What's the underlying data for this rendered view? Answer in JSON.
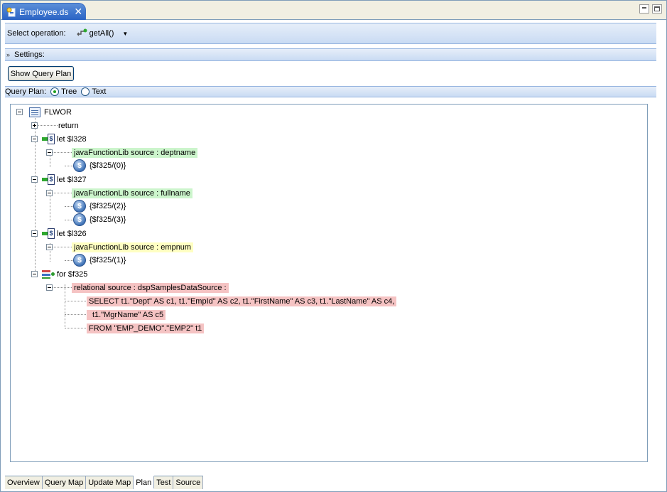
{
  "editor": {
    "tab_title": "Employee.ds",
    "close_glyph": "✕"
  },
  "operation": {
    "label": "Select operation:",
    "value": "getAll()"
  },
  "settings": {
    "label": "Settings:"
  },
  "show_plan_button": "Show Query Plan",
  "query_plan": {
    "label": "Query Plan:",
    "options": [
      {
        "label": "Tree",
        "selected": true
      },
      {
        "label": "Text",
        "selected": false
      }
    ]
  },
  "tree": {
    "root": "FLWOR",
    "return": "return",
    "let1": "let $l328",
    "let1_source": "javaFunctionLib source : deptname",
    "let1_val": "{$f325/(0)}",
    "let2": "let $l327",
    "let2_source": "javaFunctionLib source : fullname",
    "let2_val_a": "{$f325/(2)}",
    "let2_val_b": "{$f325/(3)}",
    "let3": "let $l326",
    "let3_source": "javaFunctionLib source : empnum",
    "let3_val": "{$f325/(1)}",
    "for": "for $f325",
    "rel_source": "relational source : dspSamplesDataSource :",
    "sql1": "SELECT t1.\"Dept\" AS c1, t1.\"EmpId\" AS c2, t1.\"FirstName\" AS c3, t1.\"LastName\" AS c4,",
    "sql2": "t1.\"MgrName\" AS c5",
    "sql3": "FROM \"EMP_DEMO\".\"EMP2\" t1"
  },
  "bottom_tabs": [
    {
      "label": "Overview",
      "active": false
    },
    {
      "label": "Query Map",
      "active": false
    },
    {
      "label": "Update Map",
      "active": false
    },
    {
      "label": "Plan",
      "active": true
    },
    {
      "label": "Test",
      "active": false
    },
    {
      "label": "Source",
      "active": false
    }
  ],
  "colors": {
    "accent": "#2a63c5",
    "green_highlight": "#ccf5cc",
    "yellow_highlight": "#ffffc2",
    "red_highlight": "#f5c3c3"
  }
}
